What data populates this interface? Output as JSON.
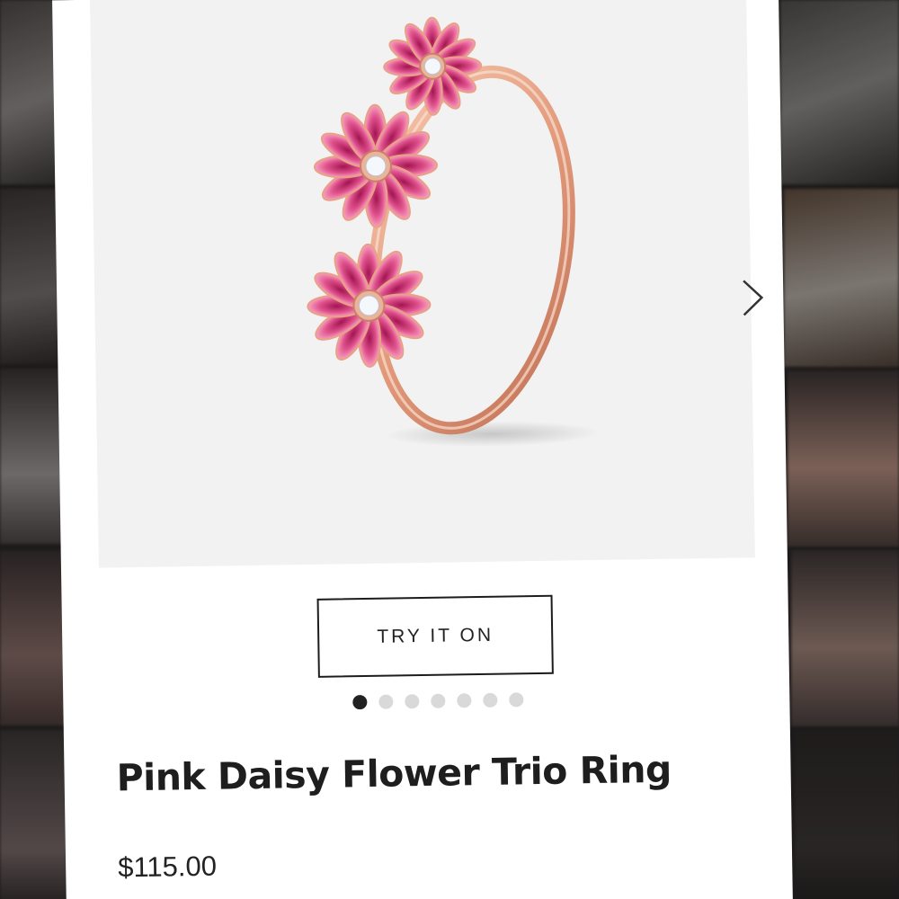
{
  "product": {
    "title": "Pink Daisy Flower Trio Ring",
    "price": "$115.00"
  },
  "gallery": {
    "try_on_label": "TRY IT ON",
    "next_icon": "chevron-right-icon",
    "image_count": 7,
    "active_index": 0
  },
  "colors": {
    "card_background": "#ffffff",
    "image_background": "#f2f2f2",
    "ring_metal": "#e7a586",
    "petal_pink": "#d93b7c",
    "active_dot": "#222222",
    "inactive_dot": "#d9d9d9"
  }
}
